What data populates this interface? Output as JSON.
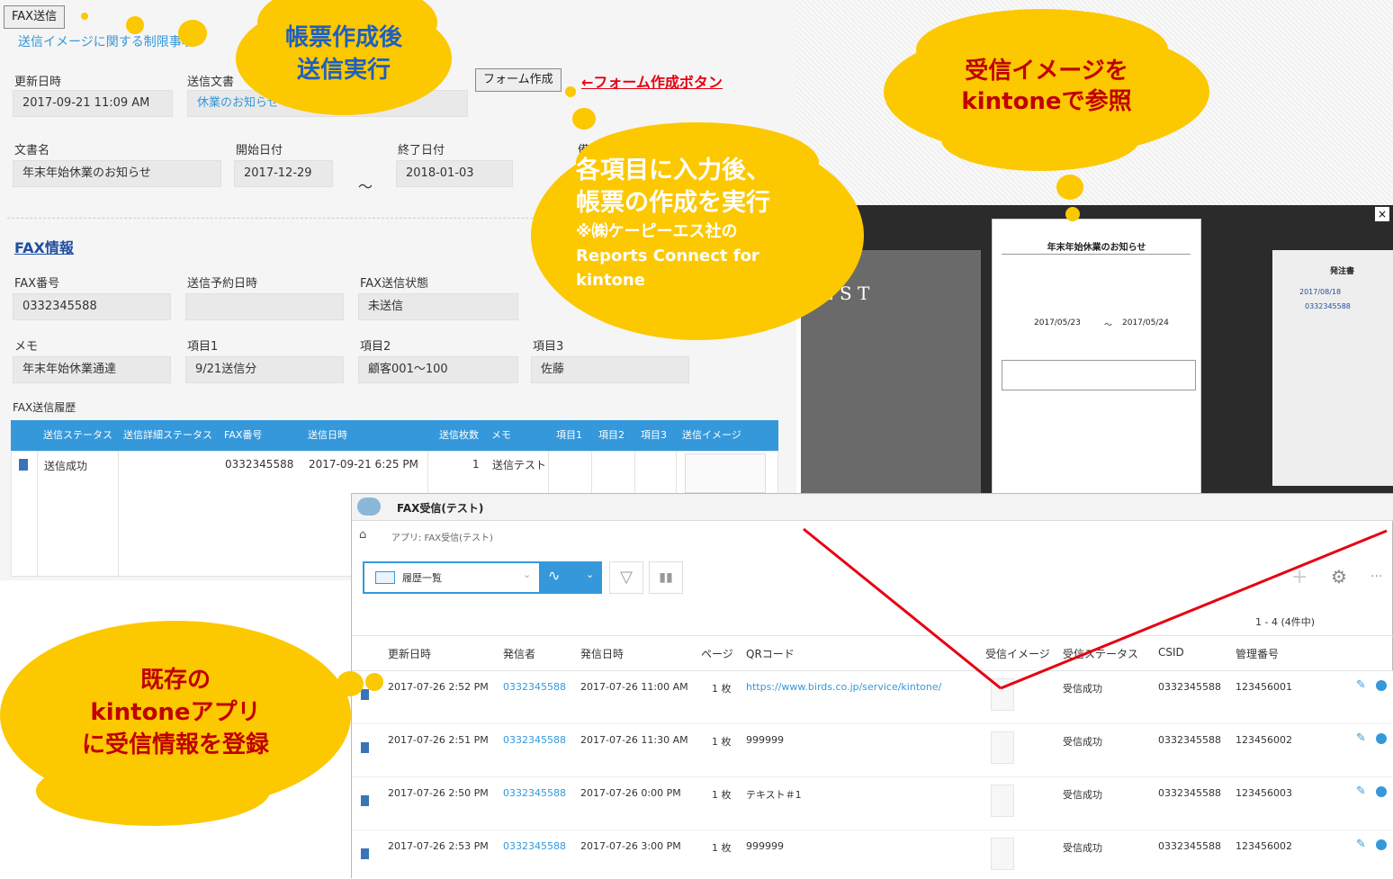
{
  "form": {
    "fax_send_button": "FAX送信",
    "restriction_link": "送信イメージに関する制限事項",
    "updated_label": "更新日時",
    "updated_value": "2017-09-21 11:09 AM",
    "send_doc_label": "送信文書",
    "send_doc_value": "休業のお知らせ",
    "form_create_button": "フォーム作成",
    "form_create_note": "←フォーム作成ボタン",
    "doc_name_label": "文書名",
    "doc_name_value": "年末年始休業のお知らせ",
    "start_label": "開始日付",
    "start_value": "2017-12-29",
    "tilde": "～",
    "end_label": "終了日付",
    "end_value": "2018-01-03",
    "remarks_label": "備考",
    "fax_info_heading": "FAX情報",
    "fax_no_label": "FAX番号",
    "fax_no_value": "0332345588",
    "reserve_label": "送信予約日時",
    "reserve_value": "",
    "status_label": "FAX送信状態",
    "status_value": "未送信",
    "memo_label": "メモ",
    "memo_value": "年末年始休業通達",
    "item1_label": "項目1",
    "item1_value": "9/21送信分",
    "item2_label": "項目2",
    "item2_value": "顧客001～100",
    "item3_label": "項目3",
    "item3_value": "佐藤",
    "history_label": "FAX送信履歴",
    "history_headers": [
      "送信ステータス",
      "送信詳細ステータス",
      "FAX番号",
      "送信日時",
      "送信枚数",
      "メモ",
      "項目1",
      "項目2",
      "項目3",
      "送信イメージ"
    ],
    "history_row": {
      "status": "送信成功",
      "fax": "0332345588",
      "date": "2017-09-21 6:25 PM",
      "pages": "1",
      "memo": "送信テスト"
    }
  },
  "fax_doc": {
    "title": "年末年始休業のお知らせ",
    "date_range_start": "2017/05/23",
    "date_range_sep": "～",
    "date_range_end": "2017/05/24"
  },
  "screen": {
    "est_text": "E S T",
    "order_title": "発注書",
    "order_date": "2017/08/18",
    "order_fax": "0332345588"
  },
  "app": {
    "title": "FAX受信(テスト)",
    "breadcrumb": "アプリ: FAX受信(テスト)",
    "view_name": "履歴一覧",
    "count": "1 - 4 (4件中)",
    "headers": [
      "更新日時",
      "発信者",
      "発信日時",
      "ページ",
      "QRコード",
      "受信イメージ",
      "受信ステータス",
      "CSID",
      "管理番号"
    ],
    "rows": [
      {
        "updated": "2017-07-26 2:52 PM",
        "sender": "0332345588",
        "sent": "2017-07-26 11:00 AM",
        "pages": "1 枚",
        "qr": "https://www.birds.co.jp/service/kintone/",
        "status": "受信成功",
        "csid": "0332345588",
        "no": "123456001"
      },
      {
        "updated": "2017-07-26 2:51 PM",
        "sender": "0332345588",
        "sent": "2017-07-26 11:30 AM",
        "pages": "1 枚",
        "qr": "999999",
        "status": "受信成功",
        "csid": "0332345588",
        "no": "123456002"
      },
      {
        "updated": "2017-07-26 2:50 PM",
        "sender": "0332345588",
        "sent": "2017-07-26 0:00 PM",
        "pages": "1 枚",
        "qr": "テキスト＃1",
        "status": "受信成功",
        "csid": "0332345588",
        "no": "123456003"
      },
      {
        "updated": "2017-07-26 2:53 PM",
        "sender": "0332345588",
        "sent": "2017-07-26 3:00 PM",
        "pages": "1 枚",
        "qr": "999999",
        "status": "受信成功",
        "csid": "0332345588",
        "no": "123456002"
      }
    ]
  },
  "callouts": {
    "c1_line1": "帳票作成後",
    "c1_line2": "送信実行",
    "c2_line1": "受信イメージを",
    "c2_line2": "kintoneで参照",
    "c3_line1": "各項目に入力後、",
    "c3_line2": "帳票の作成を実行",
    "c3_line3": "※㈱ケーピーエス社の",
    "c3_line4": "Reports Connect for",
    "c3_line5": "kintone",
    "c4_line1": "既存の",
    "c4_line2": "kintoneアプリ",
    "c4_line3": "に受信情報を登録"
  },
  "colors": {
    "accent": "#3498db",
    "callout": "#fcc800",
    "callout_text_blue": "#1f5fbf",
    "callout_text_red": "#c00000",
    "note_red": "#e60012"
  }
}
